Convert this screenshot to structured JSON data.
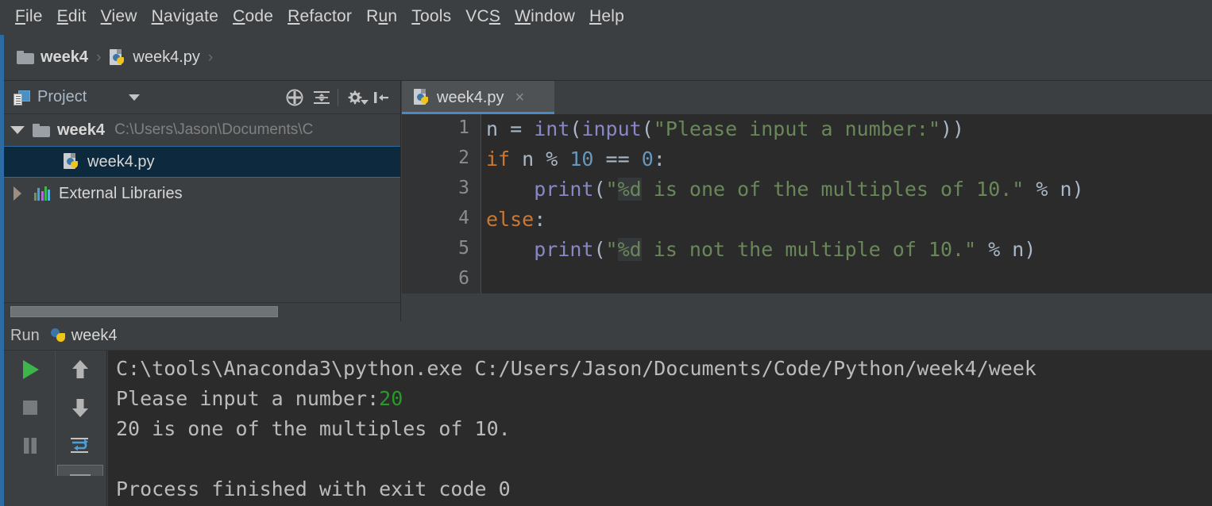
{
  "window": {
    "app": "PyCharm",
    "accent_color": "#2d6ca2",
    "background": "#3c3f41",
    "editor_background": "#2b2b2b"
  },
  "menubar": {
    "items": [
      {
        "label": "File",
        "mnemonic": "F"
      },
      {
        "label": "Edit",
        "mnemonic": "E"
      },
      {
        "label": "View",
        "mnemonic": "V"
      },
      {
        "label": "Navigate",
        "mnemonic": "N"
      },
      {
        "label": "Code",
        "mnemonic": "C"
      },
      {
        "label": "Refactor",
        "mnemonic": "R"
      },
      {
        "label": "Run",
        "mnemonic": "u"
      },
      {
        "label": "Tools",
        "mnemonic": "T"
      },
      {
        "label": "VCS",
        "mnemonic": "S"
      },
      {
        "label": "Window",
        "mnemonic": "W"
      },
      {
        "label": "Help",
        "mnemonic": "H"
      }
    ]
  },
  "breadcrumb": {
    "separator": "›",
    "items": [
      {
        "label": "week4",
        "icon": "folder-icon",
        "bold": true
      },
      {
        "label": "week4.py",
        "icon": "python-file-icon",
        "bold": false
      }
    ]
  },
  "project_panel": {
    "tab_label": "Project",
    "tab_icon": "project-panel-icon",
    "dropdown_icon": "chevron-down-icon",
    "toolbar": [
      {
        "name": "scroll-from-source-icon",
        "title": "Select Opened File"
      },
      {
        "name": "collapse-all-icon",
        "title": "Collapse All"
      },
      {
        "name": "gear-icon",
        "title": "Settings"
      },
      {
        "name": "hide-panel-icon",
        "title": "Hide"
      }
    ],
    "tree": [
      {
        "label": "week4",
        "path": "C:\\Users\\Jason\\Documents\\C",
        "icon": "folder-icon",
        "expander": "triangle-down-icon",
        "bold": true,
        "selected": false,
        "indent": 0
      },
      {
        "label": "week4.py",
        "path": "",
        "icon": "python-file-icon",
        "expander": "none",
        "bold": false,
        "selected": true,
        "indent": 1
      },
      {
        "label": "External Libraries",
        "path": "",
        "icon": "libraries-icon",
        "expander": "triangle-right-icon",
        "bold": false,
        "selected": false,
        "indent": 0
      }
    ],
    "scrollbar": {
      "name": "horizontal-scrollbar"
    }
  },
  "editor": {
    "tabs": [
      {
        "label": "week4.py",
        "icon": "python-file-icon",
        "active": true,
        "close_icon": "×"
      }
    ],
    "line_numbers": [
      "1",
      "2",
      "3",
      "4",
      "5",
      "6"
    ],
    "code_lines": [
      {
        "number": "1",
        "tokens": [
          {
            "text": "n ",
            "type": "default"
          },
          {
            "text": "= ",
            "type": "default"
          },
          {
            "text": "int",
            "type": "function"
          },
          {
            "text": "(",
            "type": "default"
          },
          {
            "text": "input",
            "type": "function"
          },
          {
            "text": "(",
            "type": "default"
          },
          {
            "text": "\"Please input a number:\"",
            "type": "string"
          },
          {
            "text": "))",
            "type": "default"
          }
        ]
      },
      {
        "number": "2",
        "tokens": [
          {
            "text": "if",
            "type": "keyword"
          },
          {
            "text": " n % ",
            "type": "default"
          },
          {
            "text": "10",
            "type": "number"
          },
          {
            "text": " == ",
            "type": "default"
          },
          {
            "text": "0",
            "type": "number"
          },
          {
            "text": ":",
            "type": "default"
          }
        ]
      },
      {
        "number": "3",
        "tokens": [
          {
            "text": "    ",
            "type": "default"
          },
          {
            "text": "print",
            "type": "function"
          },
          {
            "text": "(",
            "type": "default"
          },
          {
            "text": "\"",
            "type": "string"
          },
          {
            "text": "%d",
            "type": "format"
          },
          {
            "text": " is one of the multiples of 10.\"",
            "type": "string"
          },
          {
            "text": " % n)",
            "type": "default"
          }
        ]
      },
      {
        "number": "4",
        "tokens": [
          {
            "text": "else",
            "type": "keyword"
          },
          {
            "text": ":",
            "type": "default"
          }
        ]
      },
      {
        "number": "5",
        "tokens": [
          {
            "text": "    ",
            "type": "default"
          },
          {
            "text": "print",
            "type": "function"
          },
          {
            "text": "(",
            "type": "default"
          },
          {
            "text": "\"",
            "type": "string"
          },
          {
            "text": "%d",
            "type": "format"
          },
          {
            "text": " is not the multiple of 10.\"",
            "type": "string"
          },
          {
            "text": " % n)",
            "type": "default"
          }
        ]
      },
      {
        "number": "6",
        "tokens": []
      }
    ]
  },
  "run_panel": {
    "title": "Run",
    "config_name": "week4",
    "config_icon": "python-icon",
    "toolbar_left": [
      {
        "name": "rerun-button",
        "icon": "play-icon",
        "color": "#3cb54a"
      },
      {
        "name": "stop-button",
        "icon": "stop-square-icon",
        "color": "#787b7d"
      },
      {
        "name": "pause-button",
        "icon": "pause-bars-icon",
        "color": "#787b7d"
      }
    ],
    "toolbar_right": [
      {
        "name": "up-button",
        "icon": "arrow-up-icon",
        "color": "#b4b4b4"
      },
      {
        "name": "down-button",
        "icon": "arrow-down-icon",
        "color": "#b4b4b4"
      },
      {
        "name": "soft-wrap-button",
        "icon": "soft-wrap-icon",
        "color": "#4a9fd8"
      },
      {
        "name": "scroll-to-end-button",
        "icon": "scroll-to-end-icon",
        "color": "#b06fd0"
      }
    ],
    "console_lines": [
      {
        "segments": [
          {
            "text": "C:\\tools\\Anaconda3\\python.exe C:/Users/Jason/Documents/Code/Python/week4/week",
            "type": "output"
          }
        ]
      },
      {
        "segments": [
          {
            "text": "Please input a number:",
            "type": "output"
          },
          {
            "text": "20",
            "type": "user-input"
          }
        ]
      },
      {
        "segments": [
          {
            "text": "20 is one of the multiples of 10.",
            "type": "output"
          }
        ]
      },
      {
        "segments": []
      },
      {
        "segments": [
          {
            "text": "Process finished with exit code 0",
            "type": "output"
          }
        ]
      }
    ]
  }
}
